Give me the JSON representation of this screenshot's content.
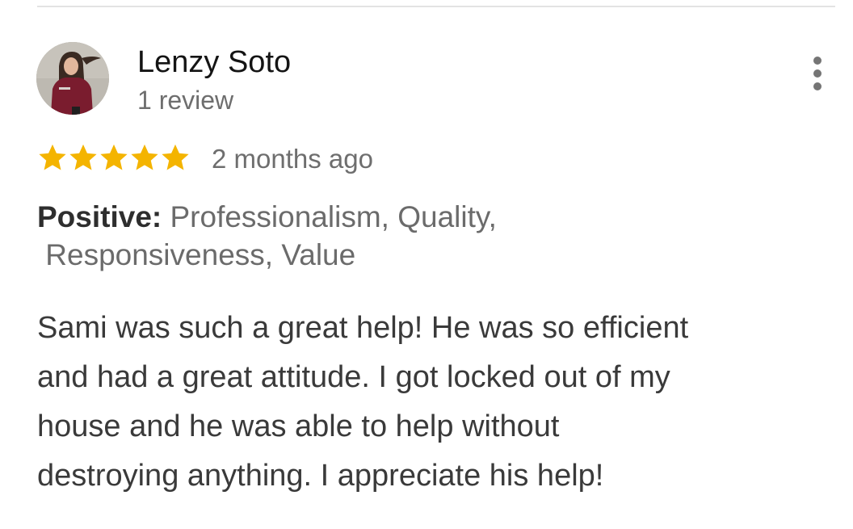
{
  "review": {
    "reviewer_name": "Lenzy Soto",
    "review_count": "1 review",
    "rating": 5,
    "rating_max": 5,
    "time_ago": "2 months ago",
    "attributes_label": "Positive:",
    "attributes_line1": "Professionalism, Quality,",
    "attributes_line2": "Responsiveness, Value",
    "text_lines": [
      "Sami was such a great help! He was so efficient",
      "and had a great attitude. I got locked out of my",
      "house and he was able to help without",
      "destroying anything. I appreciate his help!"
    ]
  },
  "icons": {
    "more": "more-vert-icon",
    "star": "star-icon"
  },
  "colors": {
    "star": "#f4b400",
    "name": "#141414",
    "secondary_text": "#6e6e6e",
    "body_text": "#3a3a3a"
  }
}
